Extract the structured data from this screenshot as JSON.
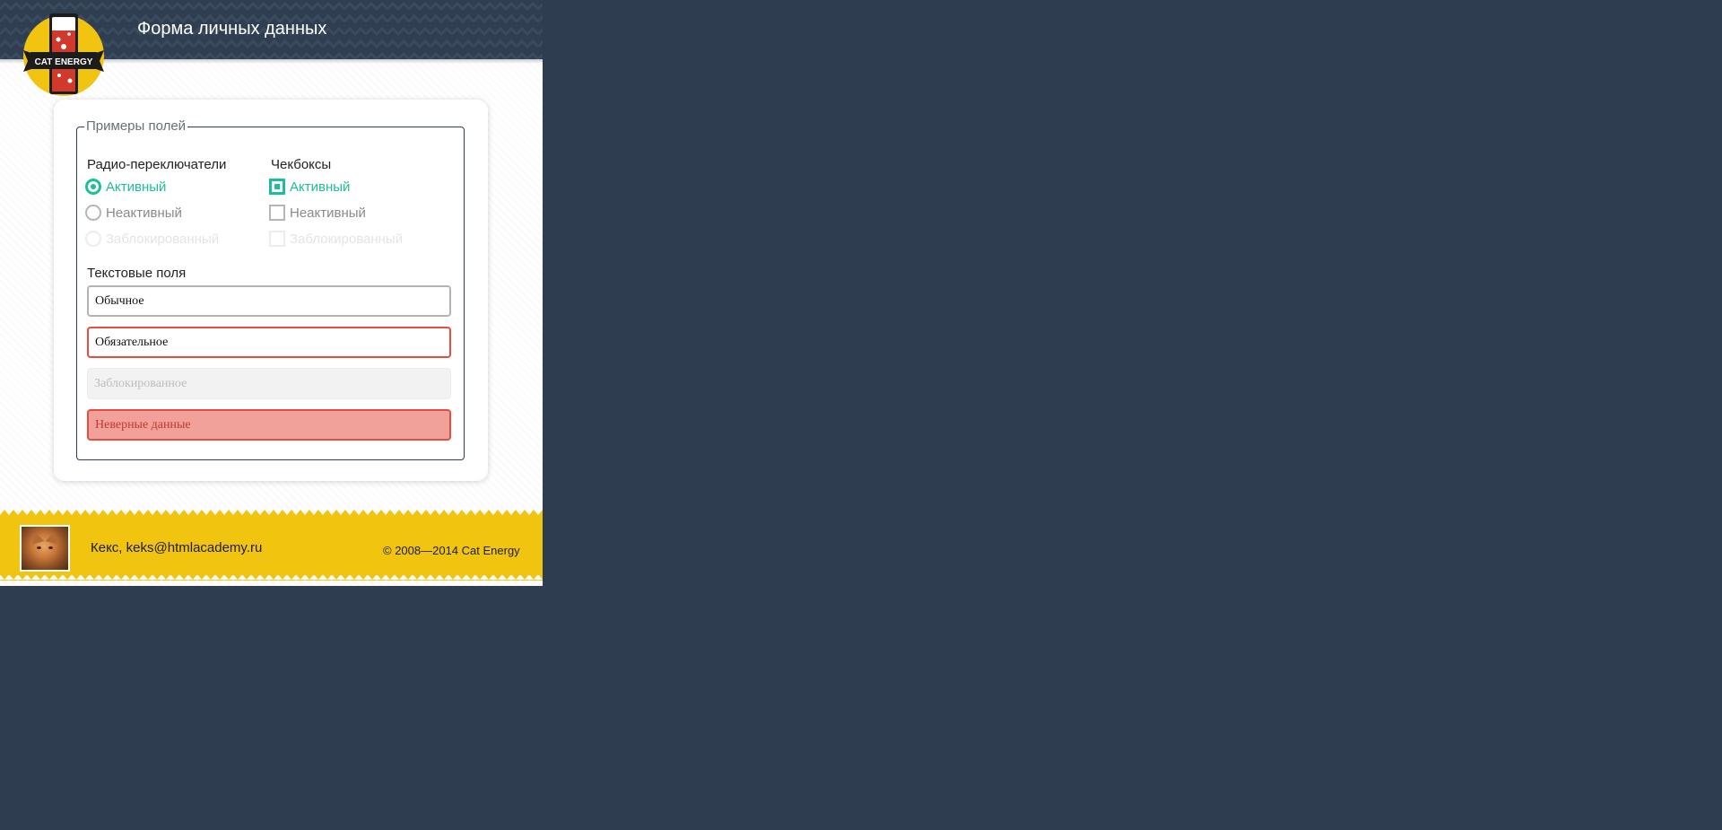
{
  "header": {
    "title": "Форма личных данных",
    "logo_text": "CAT ENERGY",
    "background_color": "#2f3f51",
    "logo_color": "#f1c40f"
  },
  "form": {
    "legend": "Примеры полей",
    "radios": {
      "title": "Радио-переключатели",
      "options": [
        {
          "label": "Активный",
          "state": "active"
        },
        {
          "label": "Неактивный",
          "state": "inactive"
        },
        {
          "label": "Заблокированный",
          "state": "disabled"
        }
      ]
    },
    "checkboxes": {
      "title": "Чекбоксы",
      "options": [
        {
          "label": "Активный",
          "state": "active"
        },
        {
          "label": "Неактивный",
          "state": "inactive"
        },
        {
          "label": "Заблокированный",
          "state": "disabled"
        }
      ]
    },
    "text_fields": {
      "title": "Текстовые поля",
      "fields": [
        {
          "placeholder": "Обычное",
          "state": "normal"
        },
        {
          "placeholder": "Обязательное",
          "state": "required"
        },
        {
          "placeholder": "Заблокированное",
          "state": "disabled"
        },
        {
          "placeholder": "Неверные данные",
          "state": "invalid"
        }
      ]
    },
    "accent_color": "#1cbf9a",
    "error_color": "#e74c3c"
  },
  "footer": {
    "contact_name": "Кекс,",
    "contact_email": "keks@htmlacademy.ru",
    "copyright": "© 2008—2014 Cat Energy",
    "background_color": "#f1c40f"
  }
}
